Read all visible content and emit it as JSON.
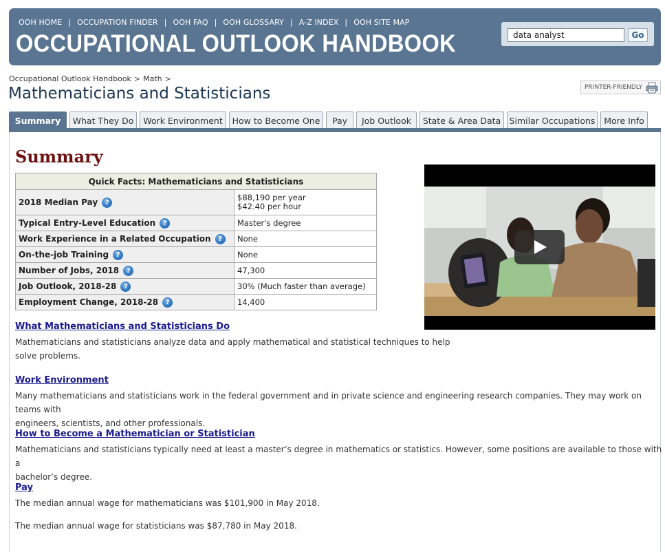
{
  "header": {
    "nav": [
      "OOH HOME",
      "OCCUPATION FINDER",
      "OOH FAQ",
      "OOH GLOSSARY",
      "A-Z INDEX",
      "OOH SITE MAP"
    ],
    "brand": "OCCUPATIONAL OUTLOOK HANDBOOK",
    "search_value": "data analyst",
    "search_button": "Go"
  },
  "breadcrumb": [
    "Occupational Outlook Handbook",
    "Math"
  ],
  "page_title": "Mathematicians and Statisticians",
  "printer_friendly": "PRINTER-FRIENDLY",
  "tabs": [
    "Summary",
    "What They Do",
    "Work Environment",
    "How to Become One",
    "Pay",
    "Job Outlook",
    "State & Area Data",
    "Similar Occupations",
    "More Info"
  ],
  "summary_heading": "Summary",
  "quick_facts": {
    "title": "Quick Facts: Mathematicians and Statisticians",
    "rows": [
      {
        "label": "2018 Median Pay",
        "value": "$88,190 per year",
        "value2": "$42.40 per hour"
      },
      {
        "label": "Typical Entry-Level Education",
        "value": "Master's degree"
      },
      {
        "label": "Work Experience in a Related Occupation",
        "value": "None"
      },
      {
        "label": "On-the-job Training",
        "value": "None"
      },
      {
        "label": "Number of Jobs, 2018",
        "value": "47,300"
      },
      {
        "label": "Job Outlook, 2018-28",
        "value": "30% (Much faster than average)"
      },
      {
        "label": "Employment Change, 2018-28",
        "value": "14,400"
      }
    ]
  },
  "sections": [
    {
      "title": "What Mathematicians and Statisticians Do",
      "text": [
        "Mathematicians and statisticians analyze data and apply mathematical and statistical techniques to help",
        "solve problems."
      ]
    },
    {
      "title": "Work Environment",
      "text": [
        "Many mathematicians and statisticians work in the federal government and in private science and engineering research companies. They may work on teams with",
        "engineers, scientists, and other professionals."
      ]
    },
    {
      "title": "How to Become a Mathematician or Statistician",
      "text": [
        "Mathematicians and statisticians typically need at least a master’s degree in mathematics or statistics. However, some positions are available to those with a",
        "bachelor’s degree."
      ]
    },
    {
      "title": "Pay",
      "text": [
        "The median annual wage for mathematicians was $101,900 in May 2018."
      ],
      "text2": "The median annual wage for statisticians was $87,780 in May 2018."
    }
  ],
  "icons": {
    "help": "help-question-icon",
    "printer": "printer-icon",
    "play": "play-icon"
  },
  "colors": {
    "banner": "#5a7591",
    "heading": "#6e1111",
    "link": "#1a1a8f"
  }
}
